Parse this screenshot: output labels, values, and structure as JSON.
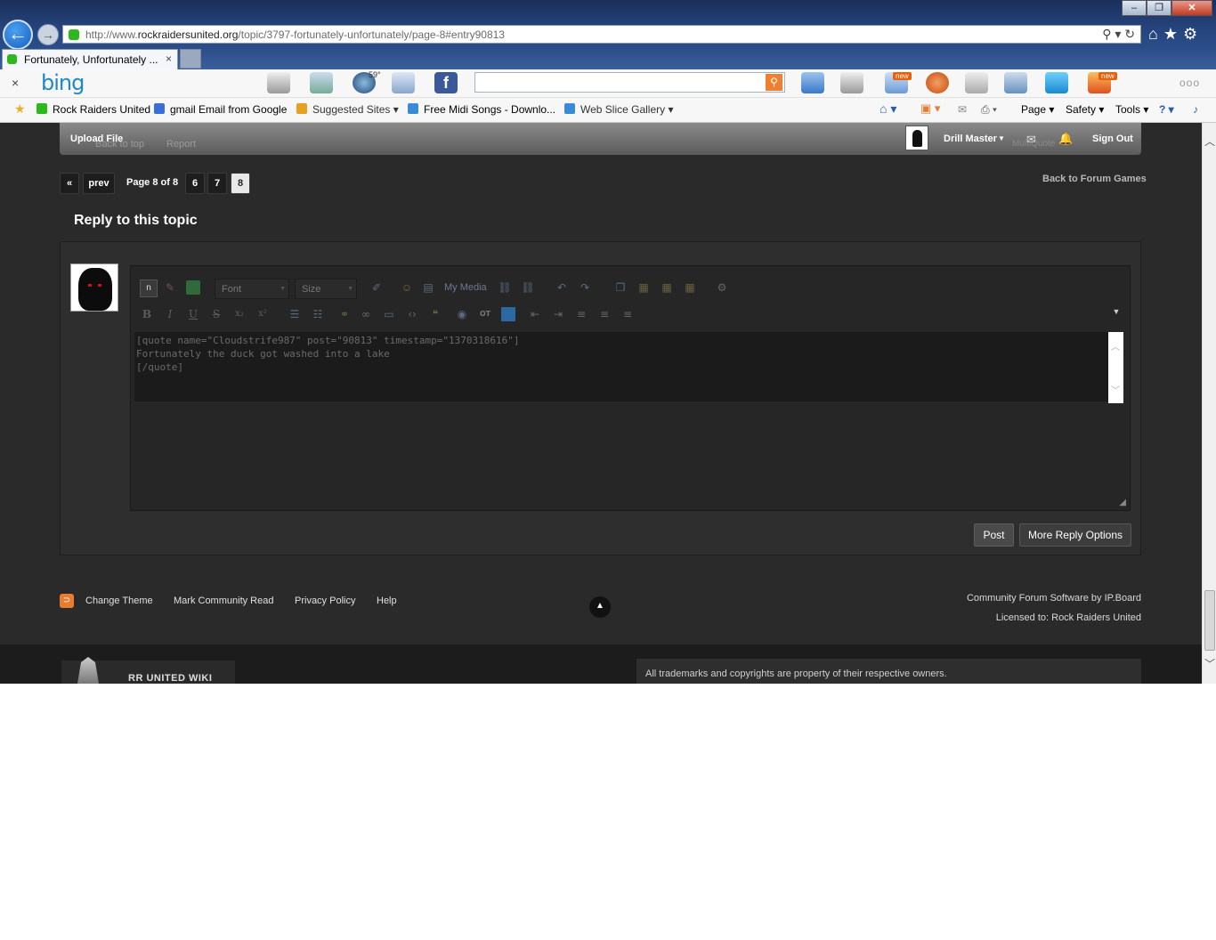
{
  "browser": {
    "url_prefix": "http://www.",
    "url_domain": "rockraidersunited.org",
    "url_path": "/topic/3797-fortunately-unfortunately/page-8#entry90813",
    "tab_title": "Fortunately, Unfortunately ...",
    "tab_close": "×",
    "back_glyph": "←",
    "forward_glyph": "→",
    "address_tools": "⚲ ▾ ↻",
    "nav_icons": "⌂★⚙",
    "window_min": "–",
    "window_max": "❐",
    "window_close": "✕"
  },
  "bing_bar": {
    "close": "×",
    "logo": "bing",
    "weather": "59°",
    "badge_new": "new",
    "search_value": "",
    "more": "ooo"
  },
  "favorites": {
    "items": [
      {
        "label": "Rock Raiders United",
        "icon": "green-gem-icon",
        "color": "#2db81d"
      },
      {
        "label": "gmail Email from Google",
        "icon": "google-icon",
        "color": "#3b6fd8"
      },
      {
        "label": "Suggested Sites ▾",
        "icon": "suggested-sites-icon",
        "color": "#e8a020"
      },
      {
        "label": "Free Midi Songs - Downlo...",
        "icon": "ie-page-icon",
        "color": "#3a8ad8"
      },
      {
        "label": "Web Slice Gallery ▾",
        "icon": "web-slice-icon",
        "color": "#3a8ad8"
      }
    ],
    "commands": [
      "Page ▾",
      "Safety ▾",
      "Tools ▾",
      "? ▾"
    ]
  },
  "userbar": {
    "upload_file": "Upload File",
    "ghost_back_to_top": "Back to top",
    "ghost_report": "Report",
    "user_name": "Drill Master",
    "user_caret": "▼",
    "ghost_multiquote": "MultiQuote",
    "sign_out": "Sign Out"
  },
  "pagination": {
    "first": "«",
    "prev": "prev",
    "page_of": "Page 8 of 8",
    "pages": [
      "6",
      "7",
      "8"
    ],
    "current": "8",
    "back_to_forum": "Back to Forum Games"
  },
  "reply": {
    "heading": "Reply to this topic",
    "toolbar": {
      "source": "n",
      "font_label": "Font",
      "size_label": "Size",
      "my_media": "My Media",
      "format_buttons": [
        "B",
        "I",
        "U",
        "S",
        "x₂",
        "x²"
      ]
    },
    "text_lines": [
      "[quote name=\"Cloudstrife987\" post=\"90813\" timestamp=\"1370318616\"]",
      "Fortunately the duck got washed into a lake",
      "[/quote]"
    ],
    "post_button": "Post",
    "more_options_button": "More Reply Options"
  },
  "footer": {
    "rss": "⊃",
    "links": [
      "Change Theme",
      "Mark Community Read",
      "Privacy Policy",
      "Help"
    ],
    "to_top": "▲",
    "credit_software": "Community Forum Software by IP.Board",
    "credit_license": "Licensed to: Rock Raiders United",
    "wiki_label": "RR UNITED WIKI",
    "trademark": "All trademarks and copyrights are property of their respective owners."
  },
  "colors": {
    "page_bg": "#2a2a2a",
    "userbar": "#6e6e6e",
    "accent_rss": "#e97c2e",
    "bing_blue": "#1e88c9"
  }
}
